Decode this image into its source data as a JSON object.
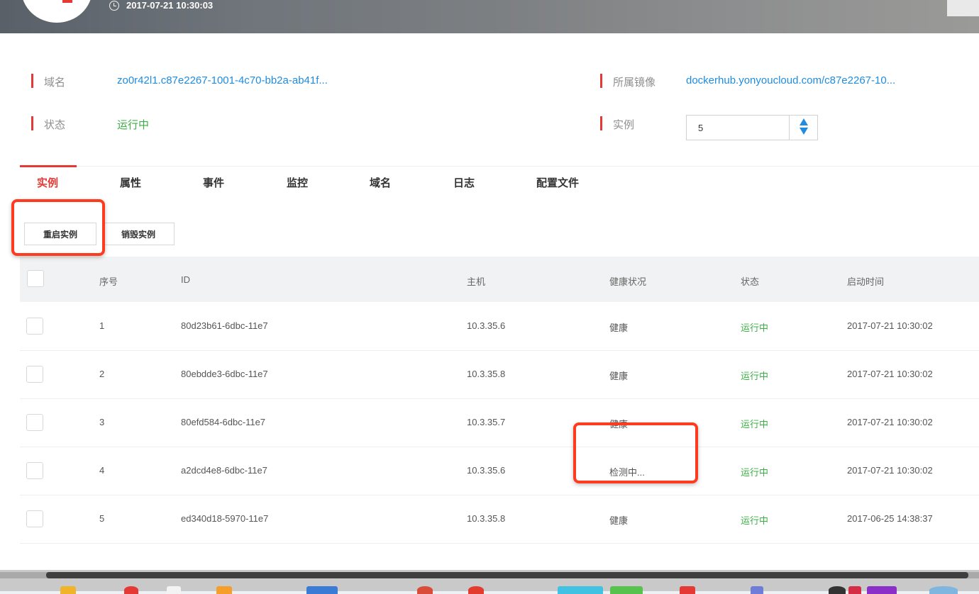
{
  "header": {
    "timestamp": "2017-07-21 10:30:03"
  },
  "info": {
    "domain_label": "域名",
    "domain_value": "zo0r42l1.c87e2267-1001-4c70-bb2a-ab41f...",
    "image_label": "所属镜像",
    "image_value": "dockerhub.yonyoucloud.com/c87e2267-10...",
    "status_label": "状态",
    "status_value": "运行中",
    "instances_label": "实例",
    "instances_value": "5"
  },
  "tabs": [
    {
      "label": "实例",
      "active": true
    },
    {
      "label": "属性"
    },
    {
      "label": "事件"
    },
    {
      "label": "监控"
    },
    {
      "label": "域名"
    },
    {
      "label": "日志"
    },
    {
      "label": "配置文件"
    }
  ],
  "actions": {
    "restart": "重启实例",
    "destroy": "销毁实例"
  },
  "table": {
    "columns": [
      "序号",
      "ID",
      "主机",
      "健康状况",
      "状态",
      "启动时间"
    ],
    "rows": [
      {
        "no": "1",
        "id": "80d23b61-6dbc-11e7",
        "host": "10.3.35.6",
        "health": "健康",
        "status": "运行中",
        "start": "2017-07-21 10:30:02"
      },
      {
        "no": "2",
        "id": "80ebdde3-6dbc-11e7",
        "host": "10.3.35.8",
        "health": "健康",
        "status": "运行中",
        "start": "2017-07-21 10:30:02"
      },
      {
        "no": "3",
        "id": "80efd584-6dbc-11e7",
        "host": "10.3.35.7",
        "health": "健康",
        "status": "运行中",
        "start": "2017-07-21 10:30:02"
      },
      {
        "no": "4",
        "id": "a2dcd4e8-6dbc-11e7",
        "host": "10.3.35.6",
        "health": "检测中...",
        "status": "运行中",
        "start": "2017-07-21 10:30:02"
      },
      {
        "no": "5",
        "id": "ed340d18-5970-11e7",
        "host": "10.3.35.8",
        "health": "健康",
        "status": "运行中",
        "start": "2017-06-25 14:38:37"
      }
    ]
  },
  "colors": {
    "accent_red": "#e53935",
    "link_blue": "#1f8ce0",
    "status_green": "#3cae46",
    "annotation_red": "#ff3b1f"
  }
}
